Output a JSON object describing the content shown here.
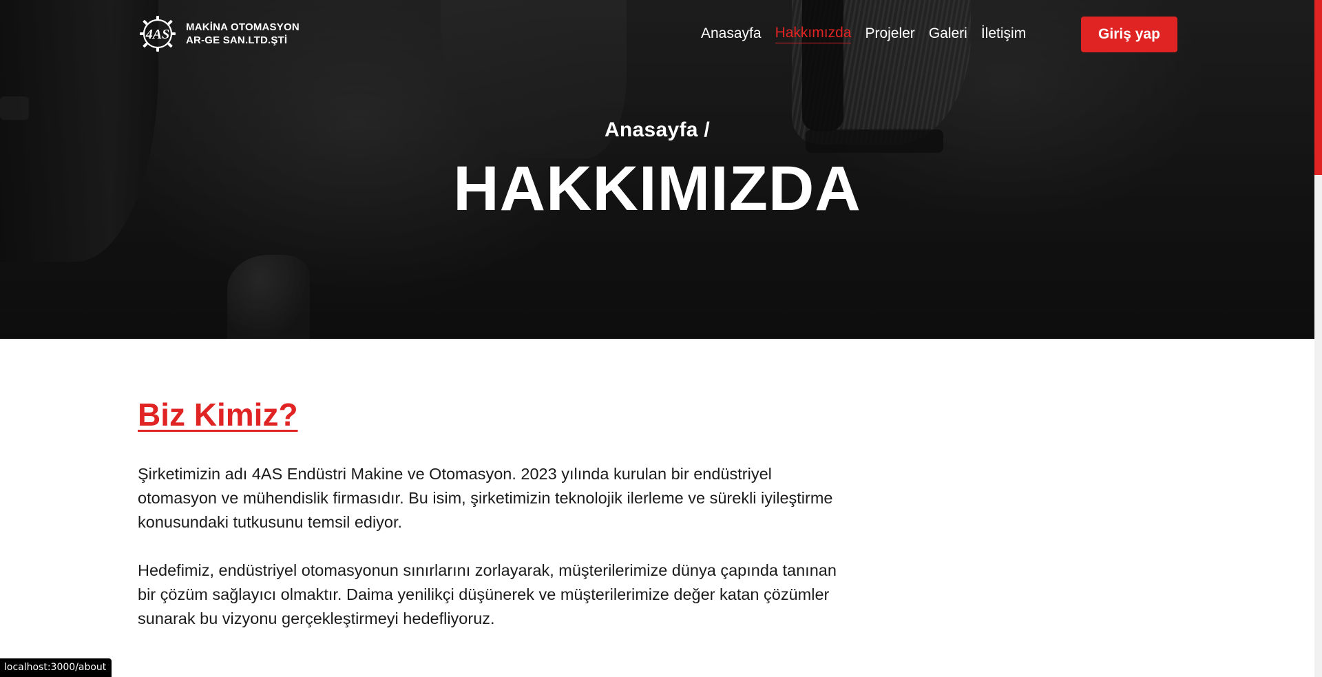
{
  "brand": {
    "logo_icon": "gear-4as-icon",
    "logo_mark_text": "4AS",
    "name_line1": "MAKİNA OTOMASYON",
    "name_line2": "AR-GE SAN.LTD.ŞTİ"
  },
  "nav": {
    "items": [
      {
        "label": "Anasayfa",
        "active": false
      },
      {
        "label": "Hakkımızda",
        "active": true
      },
      {
        "label": "Projeler",
        "active": false
      },
      {
        "label": "Galeri",
        "active": false
      },
      {
        "label": "İletişim",
        "active": false
      }
    ],
    "login_label": "Giriş yap"
  },
  "hero": {
    "breadcrumb": "Anasayfa /",
    "title": "HAKKIMIZDA"
  },
  "about": {
    "heading": "Biz Kimiz?",
    "paragraphs": [
      "Şirketimizin adı 4AS Endüstri Makine ve Otomasyon. 2023 yılında kurulan bir endüstriyel otomasyon ve mühendislik firmasıdır. Bu isim, şirketimizin teknolojik ilerleme ve sürekli iyileştirme konusundaki tutkusunu temsil ediyor.",
      "Hedefimiz, endüstriyel otomasyonun sınırlarını zorlayarak, müşterilerimize dünya çapında tanınan bir çözüm sağlayıcı olmaktır. Daima yenilikçi düşünerek ve müşterilerimize değer katan çözümler sunarak bu vizyonu gerçekleştirmeyi hedefliyoruz."
    ]
  },
  "status_url": "localhost:3000/about",
  "colors": {
    "accent": "#e02424",
    "text": "#1c1c1c",
    "hero_bg": "#1d1d1d"
  }
}
